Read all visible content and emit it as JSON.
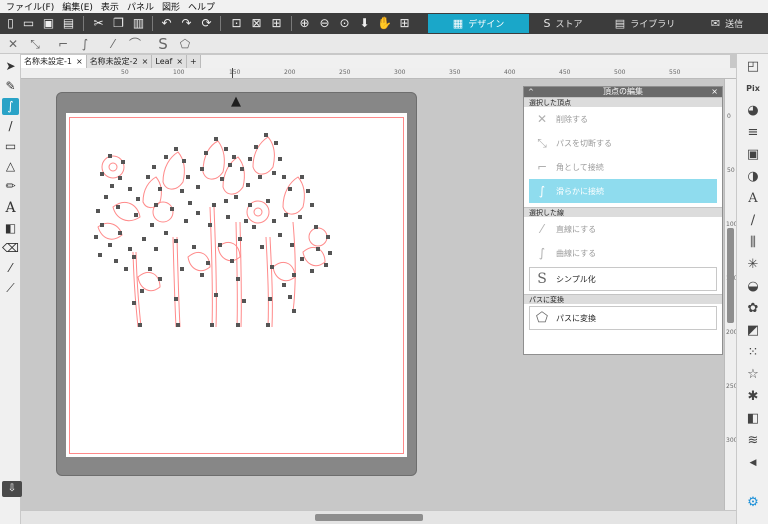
{
  "menu": [
    "ファイル(F)",
    "編集(E)",
    "表示",
    "パネル",
    "図形",
    "ヘルプ"
  ],
  "toolbar": {
    "icons": [
      "new-file-icon",
      "open-file-icon",
      "save-icon",
      "print-icon",
      "cut-icon",
      "copy-icon",
      "paste-icon",
      "undo-icon",
      "redo-icon",
      "rotate-icon",
      "group-icon",
      "ungroup-icon",
      "select-all-icon",
      "zoom-in-icon",
      "zoom-out-icon",
      "zoom-fit-icon",
      "move-down-icon",
      "pan-hand-icon",
      "add-page-icon"
    ],
    "modes": [
      {
        "label": "デザイン",
        "icon": "▦",
        "active": true
      },
      {
        "label": "ストア",
        "icon": "S",
        "active": false
      },
      {
        "label": "ライブラリ",
        "icon": "▤",
        "active": false
      },
      {
        "label": "送信",
        "icon": "✉",
        "active": false
      }
    ]
  },
  "doc_tabs": [
    {
      "label": "名称未設定-1",
      "active": true
    },
    {
      "label": "名称未設定-2",
      "active": false
    },
    {
      "label": "Leaf",
      "active": false
    }
  ],
  "ruler_h": [
    "0",
    "50",
    "100",
    "150",
    "200",
    "250",
    "300",
    "350",
    "400",
    "450",
    "500",
    "550"
  ],
  "ruler_v": [
    "0",
    "50",
    "100",
    "150",
    "200",
    "250",
    "300"
  ],
  "panel": {
    "title": "頂点の編集",
    "sections": [
      {
        "header": "選択した頂点",
        "items": [
          {
            "label": "削除する",
            "icon": "✕",
            "selected": false
          },
          {
            "label": "パスを切断する",
            "icon": "⤡",
            "selected": false
          },
          {
            "label": "角として接続",
            "icon": "⌐",
            "selected": false
          },
          {
            "label": "滑らかに接続",
            "icon": "∫",
            "selected": true
          }
        ]
      },
      {
        "header": "選択した線",
        "items": [
          {
            "label": "直線にする",
            "icon": "⁄",
            "selected": false
          },
          {
            "label": "曲線にする",
            "icon": "∫",
            "selected": false
          }
        ],
        "boxes": [
          {
            "label": "シンプル化",
            "icon": "S"
          }
        ]
      },
      {
        "header": "パスに変換",
        "boxes": [
          {
            "label": "パスに変換",
            "icon": "⬠"
          }
        ]
      }
    ]
  },
  "colors": {
    "accent": "#1aa7c9",
    "toolbar_bg": "#3c3c3c",
    "mat": "#878787",
    "cut_line": "#ff8a8a",
    "nodes": "#555555",
    "selected_item": "#8fdcee"
  }
}
